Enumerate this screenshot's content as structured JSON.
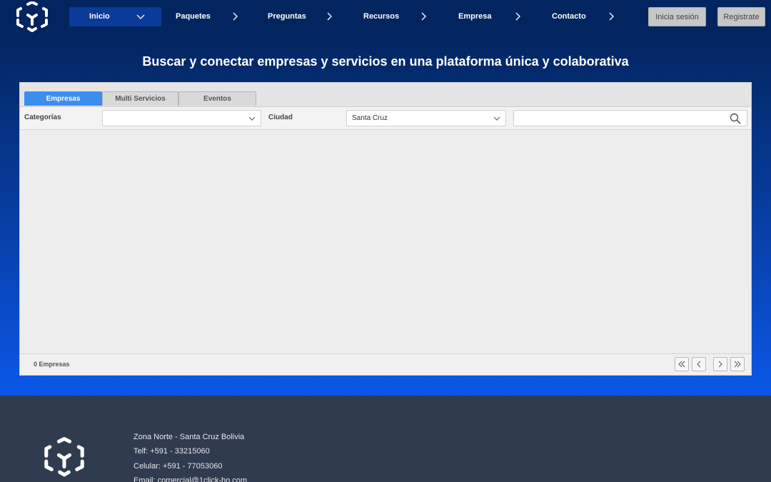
{
  "nav": {
    "items": [
      {
        "label": "Inicio",
        "icon": "chevron-down-icon"
      },
      {
        "label": "Paquetes",
        "icon": "chevron-right-icon"
      },
      {
        "label": "Preguntas",
        "icon": "chevron-right-icon"
      },
      {
        "label": "Recursos",
        "icon": "chevron-right-icon"
      },
      {
        "label": "Empresa",
        "icon": "chevron-right-icon"
      },
      {
        "label": "Contacto",
        "icon": "chevron-right-icon"
      }
    ],
    "login_label": "Inicia sesión",
    "register_label": "Registrate"
  },
  "hero": {
    "headline": "Buscar y conectar empresas y servicios en una plataforma única y colaborativa"
  },
  "panel": {
    "tabs": [
      {
        "label": "Empresas",
        "active": true
      },
      {
        "label": "Multi Servicios",
        "active": false
      },
      {
        "label": "Eventos",
        "active": false
      }
    ],
    "filters": {
      "category_label": "Categorías",
      "category_value": "",
      "city_label": "Ciudad",
      "city_value": "Santa Cruz",
      "search_value": ""
    },
    "count_text": "0 Empresas"
  },
  "footer": {
    "address": "Zona Norte - Santa Cruz Bolivia",
    "phone": "Telf: +591 - 33215060",
    "mobile": "Celular: +591 - 77053060",
    "email": "Email: comercial@1click-bo.com"
  },
  "colors": {
    "topbar": "#03255f",
    "accent": "#3b8ef0",
    "hero_bottom": "#0a57e8",
    "footer": "#2f3b4e"
  }
}
